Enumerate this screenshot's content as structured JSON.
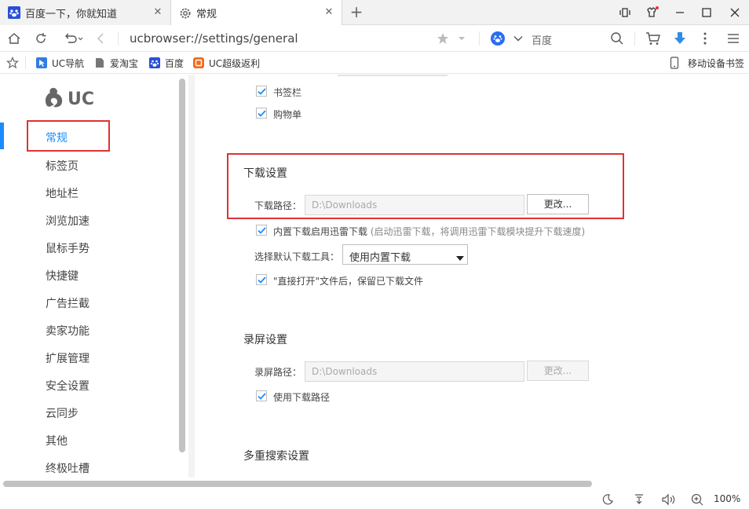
{
  "tabs": [
    {
      "title": "百度一下，你就知道",
      "icon": "baidu-paw-icon"
    },
    {
      "title": "常规",
      "icon": "gear-icon"
    }
  ],
  "toolbar": {
    "url": "ucbrowser://settings/general",
    "search_engine": "百度"
  },
  "bookmarks": {
    "items": [
      {
        "label": "UC导航"
      },
      {
        "label": "爱淘宝"
      },
      {
        "label": "百度"
      },
      {
        "label": "UC超级返利"
      }
    ],
    "mobile_label": "移动设备书签"
  },
  "sidebar": {
    "logo_text": "UC",
    "items": [
      {
        "label": "常规",
        "active": true
      },
      {
        "label": "标签页"
      },
      {
        "label": "地址栏"
      },
      {
        "label": "浏览加速"
      },
      {
        "label": "鼠标手势"
      },
      {
        "label": "快捷键"
      },
      {
        "label": "广告拦截"
      },
      {
        "label": "卖家功能"
      },
      {
        "label": "扩展管理"
      },
      {
        "label": "安全设置"
      },
      {
        "label": "云同步"
      },
      {
        "label": "其他"
      },
      {
        "label": "终极吐槽"
      }
    ]
  },
  "content": {
    "top_checks": [
      {
        "label": "书签栏",
        "checked": true
      },
      {
        "label": "购物单",
        "checked": true
      }
    ],
    "download": {
      "title": "下载设置",
      "path_label": "下载路径：",
      "path_value": "D:\\Downloads",
      "change_button": "更改...",
      "xunlei_label": "内置下载启用迅雷下载",
      "xunlei_hint": "(启动迅雷下载，将调用迅雷下载模块提升下载速度)",
      "tool_label": "选择默认下载工具：",
      "tool_value": "使用内置下载",
      "open_keep_label": "\"直接打开\"文件后，保留已下载文件"
    },
    "record": {
      "title": "录屏设置",
      "path_label": "录屏路径：",
      "path_value": "D:\\Downloads",
      "change_button": "更改...",
      "use_download_label": "使用下载路径"
    },
    "multi_search": {
      "title": "多重搜索设置"
    }
  },
  "status": {
    "zoom": "100%"
  },
  "colors": {
    "accent": "#1a8cff",
    "highlight": "#d33333"
  }
}
